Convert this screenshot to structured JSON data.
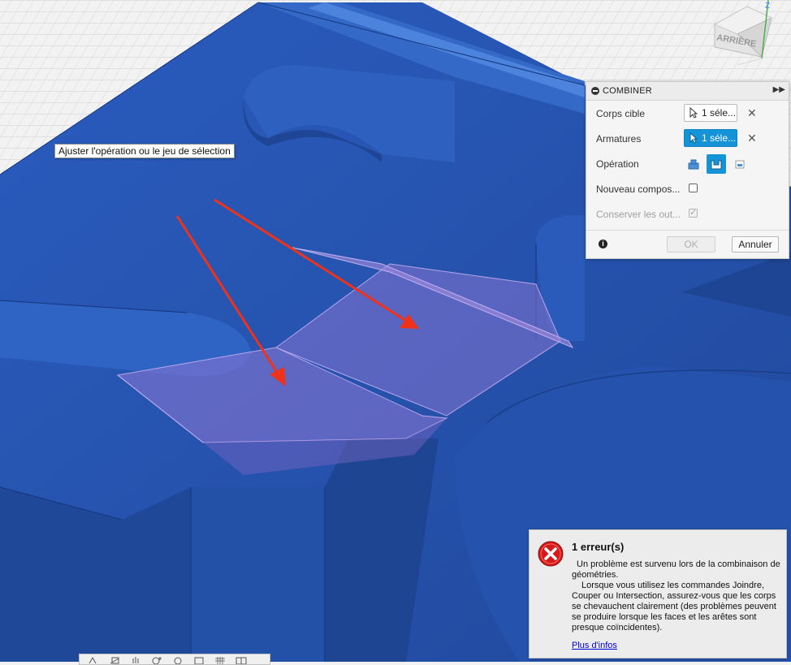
{
  "tooltip": {
    "text": "Ajuster l'opération ou le jeu de sélection"
  },
  "viewcube": {
    "face_label": "ARRIÈRE",
    "axis_z": "Z"
  },
  "combine_panel": {
    "title": "COMBINER",
    "target_body": {
      "label": "Corps cible",
      "value": "1 séle..."
    },
    "tool_bodies": {
      "label": "Armatures",
      "value": "1 séle..."
    },
    "operation": {
      "label": "Opération",
      "options": [
        "join",
        "cut",
        "intersect"
      ],
      "selected": "cut"
    },
    "new_component": {
      "label": "Nouveau compos...",
      "checked": false
    },
    "keep_tools": {
      "label": "Conserver les out...",
      "checked": true,
      "disabled": true
    },
    "ok_label": "OK",
    "cancel_label": "Annuler",
    "accent_color": "#1493d6"
  },
  "error_popup": {
    "title": "1 erreur(s)",
    "message_1": "Un problème est survenu lors de la combinaison de géométries.",
    "message_2": "Lorsque vous utilisez les commandes Joindre, Couper ou Intersection, assurez-vous que les corps se chevauchent clairement (des problèmes peuvent se produire lorsque les faces et les arêtes sont presque coïncidentes).",
    "link": "Plus d'infos",
    "icon_color": "#d61a1a"
  },
  "model": {
    "body_color": "#2655b0",
    "selection_color": "#9b7fd6",
    "annotation_color": "#f0321a"
  },
  "navbar": {
    "tools": [
      "orbit-tool",
      "look-at-tool",
      "pan-tool",
      "zoom-tool",
      "fit-tool",
      "display-settings-tool",
      "grid-settings-tool",
      "viewports-tool"
    ]
  }
}
